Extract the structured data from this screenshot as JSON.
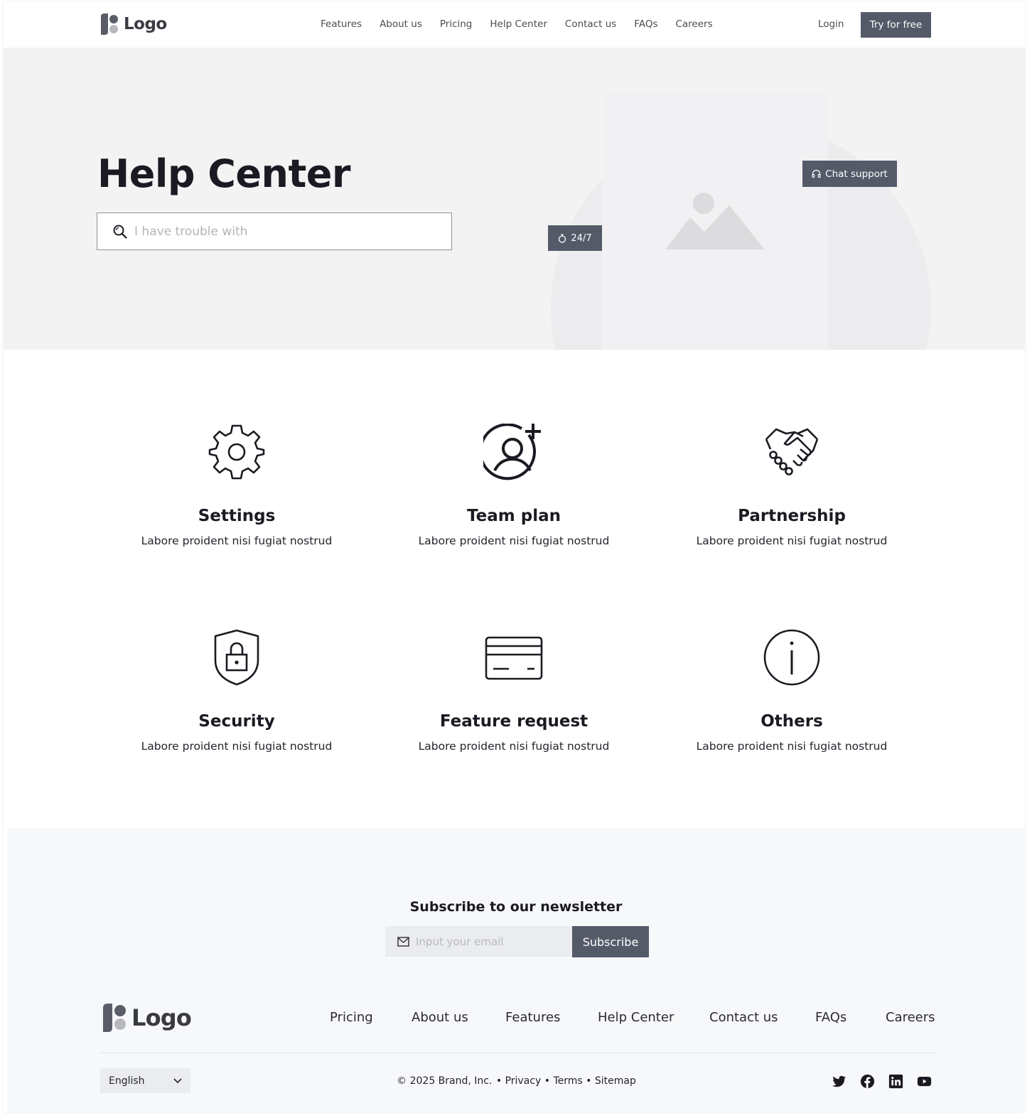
{
  "header": {
    "logo_text": "Logo",
    "nav": [
      "Features",
      "About us",
      "Pricing",
      "Help Center",
      "Contact us",
      "FAQs",
      "Careers"
    ],
    "login_label": "Login",
    "cta_label": "Try for free"
  },
  "hero": {
    "title": "Help Center",
    "search_placeholder": "I have trouble with",
    "badge_247": "24/7",
    "chat_support": "Chat support"
  },
  "categories": [
    {
      "title": "Settings",
      "desc": "Labore proident nisi fugiat nostrud",
      "icon": "gear-icon"
    },
    {
      "title": "Team plan",
      "desc": "Labore proident nisi fugiat nostrud",
      "icon": "user-plus-icon"
    },
    {
      "title": "Partnership",
      "desc": "Labore proident nisi fugiat nostrud",
      "icon": "handshake-icon"
    },
    {
      "title": "Security",
      "desc": "Labore proident nisi fugiat nostrud",
      "icon": "shield-lock-icon"
    },
    {
      "title": "Feature request",
      "desc": "Labore proident nisi fugiat nostrud",
      "icon": "credit-card-icon"
    },
    {
      "title": "Others",
      "desc": "Labore proident nisi fugiat nostrud",
      "icon": "info-icon"
    }
  ],
  "newsletter": {
    "title": "Subscribe to our newsletter",
    "email_placeholder": "Input your email",
    "button": "Subscribe"
  },
  "footer": {
    "logo_text": "Logo",
    "nav": [
      "Pricing",
      "About us",
      "Features",
      "Help Center",
      "Contact us",
      "FAQs",
      "Careers"
    ],
    "language": "English",
    "copyright": "© 2025 Brand, Inc.",
    "privacy": "Privacy",
    "terms": "Terms",
    "sitemap": "Sitemap",
    "socials": [
      "twitter-icon",
      "facebook-icon",
      "linkedin-icon",
      "youtube-icon"
    ]
  },
  "colors": {
    "accent": "#555a69",
    "hero_bg": "#f3f3f4",
    "footer_bg": "#f7f8fa"
  }
}
